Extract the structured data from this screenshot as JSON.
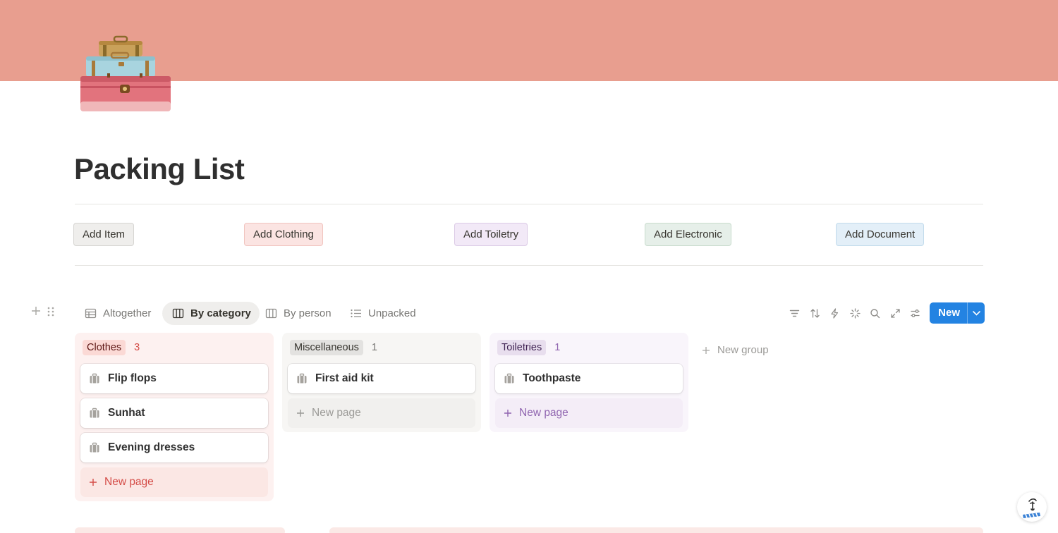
{
  "page": {
    "title": "Packing List",
    "cover_color": "#e89e8f",
    "icon": "stacked-suitcases-icon"
  },
  "actions": [
    {
      "label": "Add Item",
      "bg": "#efeeec",
      "border": "#d6d5d2"
    },
    {
      "label": "Add Clothing",
      "bg": "#fbe4e2",
      "border": "#f1c4bf"
    },
    {
      "label": "Add Toiletry",
      "bg": "#f2e9f7",
      "border": "#dccbe6"
    },
    {
      "label": "Add Electronic",
      "bg": "#e6efe9",
      "border": "#c9dccd"
    },
    {
      "label": "Add Document",
      "bg": "#e3eff8",
      "border": "#c2dbec"
    }
  ],
  "views": {
    "tabs": [
      {
        "label": "Altogether",
        "icon": "table-icon",
        "active": false
      },
      {
        "label": "By category",
        "icon": "board-icon",
        "active": true
      },
      {
        "label": "By person",
        "icon": "board-icon",
        "active": false
      },
      {
        "label": "Unpacked",
        "icon": "list-icon",
        "active": false
      }
    ],
    "tools": [
      "filter-icon",
      "sort-icon",
      "automation-icon",
      "ai-sparkle-icon",
      "search-icon",
      "expand-icon",
      "settings-icon"
    ],
    "new_label": "New"
  },
  "board": {
    "columns": [
      {
        "name": "Clothes",
        "count": "3",
        "bg": "#fdf1f0",
        "pill_bg": "#fbd9d5",
        "pill_color": "#5d1715",
        "count_color": "#d44c47",
        "new_color": "#d44c47",
        "new_bg": "#fbe7e4",
        "cards": [
          "Flip flops",
          "Sunhat",
          "Evening dresses"
        ]
      },
      {
        "name": "Miscellaneous",
        "count": "1",
        "bg": "#f7f6f4",
        "pill_bg": "#e3e2e0",
        "pill_color": "#37352f",
        "count_color": "#787774",
        "new_color": "#9b9a97",
        "new_bg": "#f1f0ee",
        "cards": [
          "First aid kit"
        ]
      },
      {
        "name": "Toiletries",
        "count": "1",
        "bg": "#f9f5fb",
        "pill_bg": "#e8deee",
        "pill_color": "#412454",
        "count_color": "#9065b0",
        "new_color": "#9065b0",
        "new_bg": "#f4edf7",
        "cards": [
          "Toothpaste"
        ]
      }
    ],
    "new_page_label": "New page",
    "new_group_label": "New group"
  }
}
